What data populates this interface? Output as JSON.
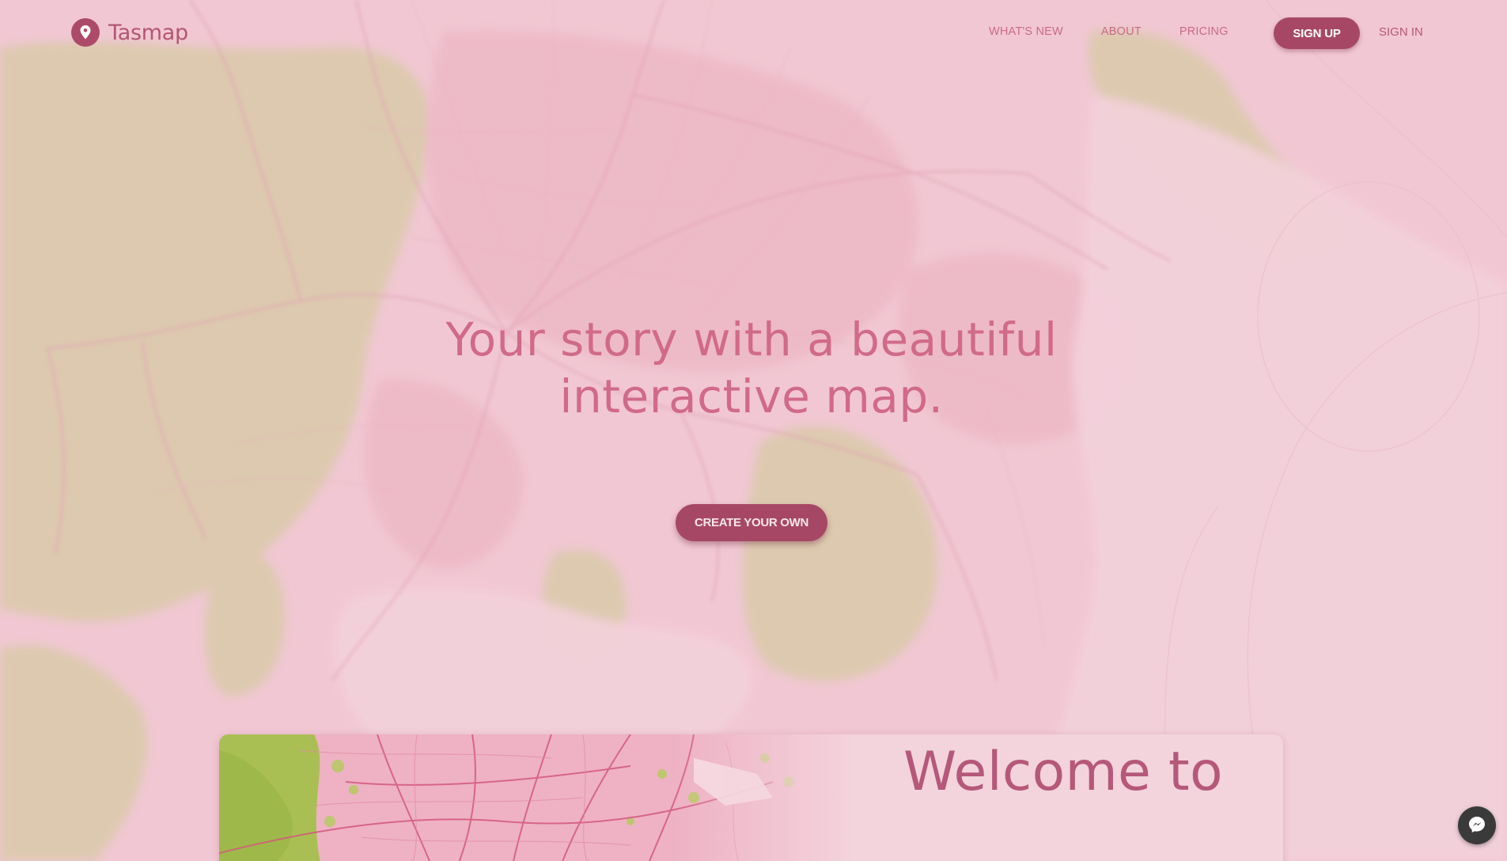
{
  "brand": {
    "name": "Tasmap",
    "logo_icon": "map-pin-icon"
  },
  "nav": {
    "links": [
      "WHAT'S NEW",
      "ABOUT",
      "PRICING"
    ],
    "signup_label": "SIGN UP",
    "signin_label": "SIGN IN"
  },
  "hero": {
    "title_line1": "Your story with a beautiful",
    "title_line2": "interactive map.",
    "cta_label": "CREATE YOUR OWN"
  },
  "welcome": {
    "heading": "Welcome to"
  },
  "messenger": {
    "icon": "messenger-icon"
  },
  "colors": {
    "accent": "#a64865",
    "brand_text": "#b25672",
    "hero_text": "#d16a8a",
    "background": "#f2cbd5",
    "land_green": "#c9c48c"
  }
}
